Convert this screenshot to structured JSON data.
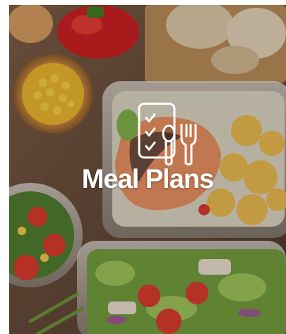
{
  "card": {
    "title": "Meal Plans",
    "icon": "meal-plan-checklist-cutlery-icon",
    "background": "meal-prep-food-photo"
  },
  "colors": {
    "text": "#ffffff",
    "overlay": "#140e0a"
  }
}
